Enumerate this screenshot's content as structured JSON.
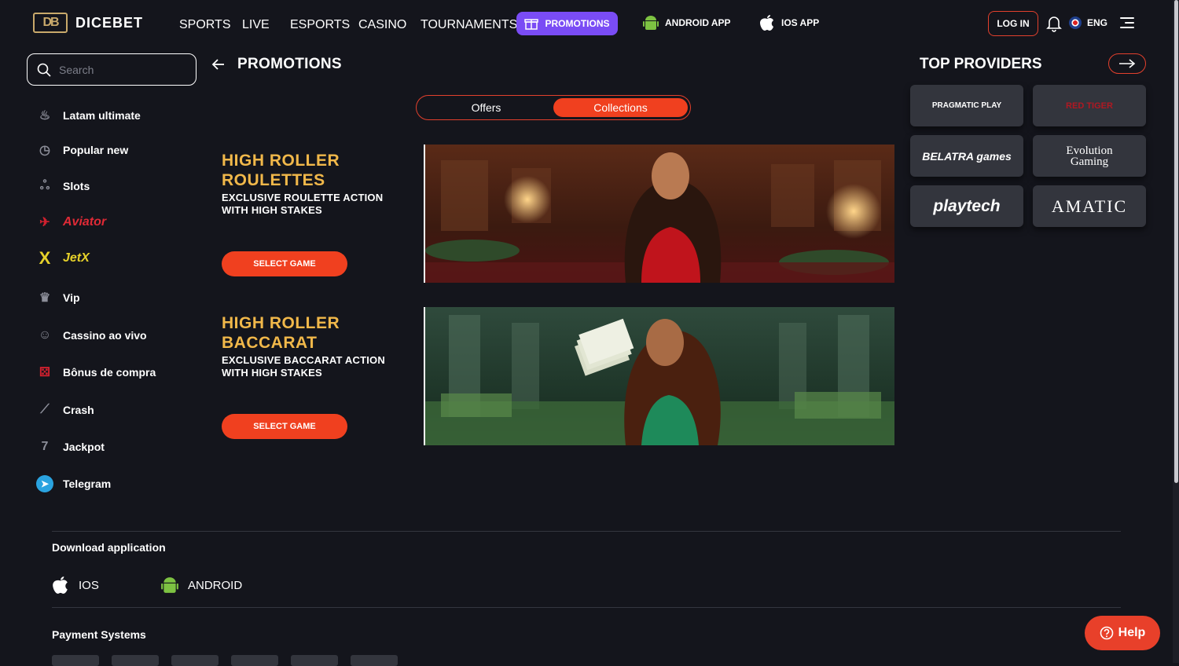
{
  "header": {
    "logo_mark": "DB",
    "brand": "DICEBET",
    "nav": [
      "SPORTS",
      "LIVE",
      "ESPORTS",
      "CASINO",
      "TOURNAMENTS"
    ],
    "promotions": "PROMOTIONS",
    "android_app": "ANDROID APP",
    "ios_app": "IOS APP",
    "login": "LOG IN",
    "language": "ENG"
  },
  "sidebar": {
    "search_placeholder": "Search",
    "items": [
      {
        "label": "Latam ultimate",
        "icon": "fire-icon"
      },
      {
        "label": "Popular new",
        "icon": "clock-icon"
      },
      {
        "label": "Slots",
        "icon": "cherries-icon"
      },
      {
        "label": "Aviator",
        "icon": "plane-icon"
      },
      {
        "label": "JetX",
        "icon": "jetx-icon"
      },
      {
        "label": "Vip",
        "icon": "crown-icon"
      },
      {
        "label": "Cassino ao vivo",
        "icon": "dealer-icon"
      },
      {
        "label": "Bônus de compra",
        "icon": "bonus-icon"
      },
      {
        "label": "Crash",
        "icon": "chart-icon"
      },
      {
        "label": "Jackpot",
        "icon": "jackpot-icon"
      },
      {
        "label": "Telegram",
        "icon": "telegram-icon"
      }
    ]
  },
  "page": {
    "title": "PROMOTIONS",
    "tabs": [
      "Offers",
      "Collections"
    ],
    "active_tab": "Collections",
    "promos": [
      {
        "title": "HIGH ROLLER ROULETTES",
        "subtitle": "EXCLUSIVE ROULETTE ACTION WITH HIGH STAKES",
        "button": "SELECT GAME"
      },
      {
        "title": "HIGH ROLLER BACCARAT",
        "subtitle": "EXCLUSIVE BACCARAT ACTION WITH HIGH STAKES",
        "button": "SELECT GAME"
      }
    ]
  },
  "providers": {
    "title": "TOP PROVIDERS",
    "items": [
      "PRAGMATIC PLAY",
      "RED TIGER",
      "BELATRA games",
      "Evolution Gaming",
      "playtech",
      "AMATIC"
    ]
  },
  "footer": {
    "download_title": "Download application",
    "ios": "IOS",
    "android": "ANDROID",
    "payment_title": "Payment Systems"
  },
  "help": "Help",
  "colors": {
    "accent": "#f0401f",
    "promo_purple": "#7a4cf5",
    "gold": "#f1b84a",
    "background": "#14151c"
  }
}
